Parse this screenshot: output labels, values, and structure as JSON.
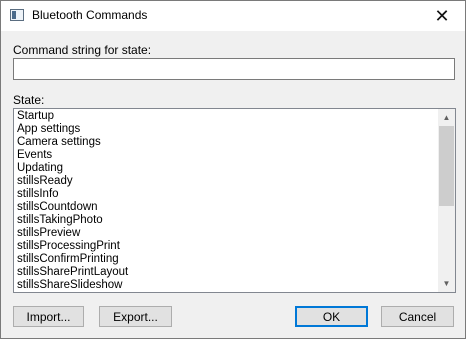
{
  "window": {
    "title": "Bluetooth Commands",
    "close_glyph": "✕"
  },
  "command_field": {
    "label": "Command string for state:",
    "value": ""
  },
  "state_list": {
    "label": "State:",
    "items": [
      "Startup",
      "App settings",
      "Camera settings",
      "Events",
      "Updating",
      "stillsReady",
      "stillsInfo",
      "stillsCountdown",
      "stillsTakingPhoto",
      "stillsPreview",
      "stillsProcessingPrint",
      "stillsConfirmPrinting",
      "stillsSharePrintLayout",
      "stillsShareSlideshow"
    ]
  },
  "buttons": {
    "import": "Import...",
    "export": "Export...",
    "ok": "OK",
    "cancel": "Cancel"
  }
}
